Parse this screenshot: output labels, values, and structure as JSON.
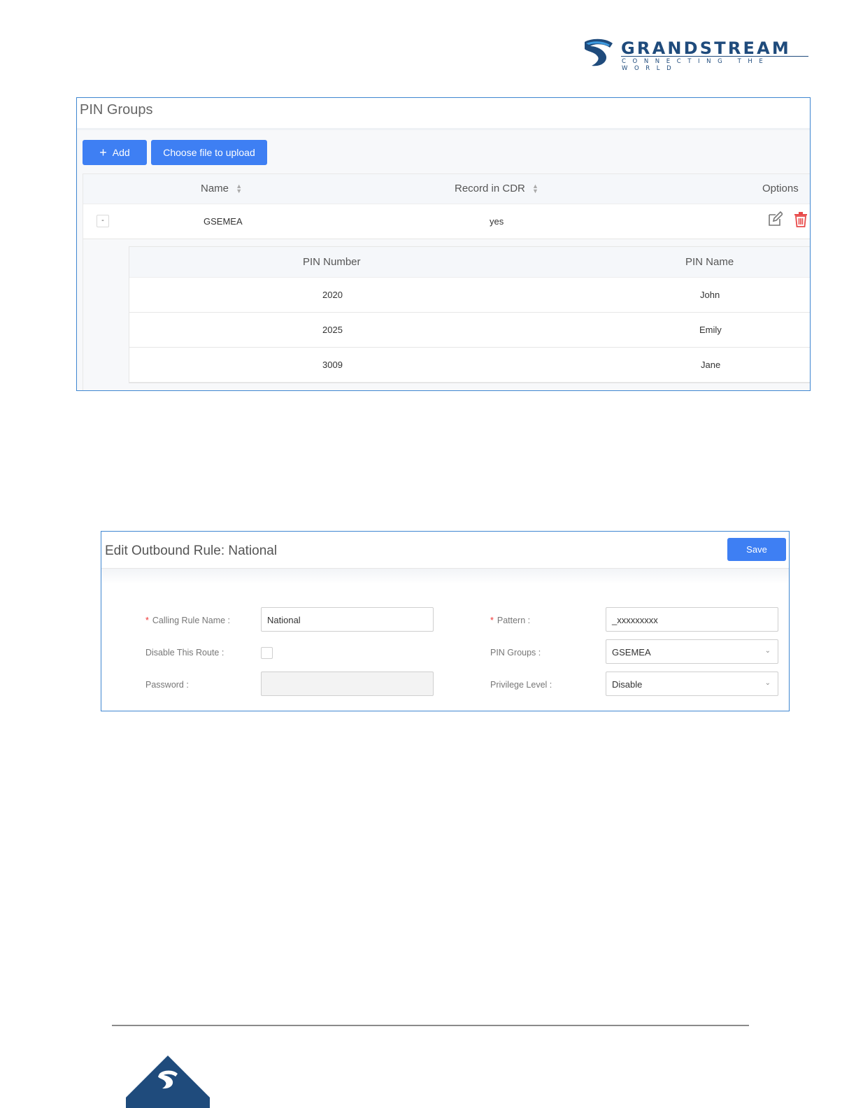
{
  "header": {
    "brand": "GRANDSTREAM",
    "tagline": "CONNECTING THE WORLD",
    "brand_color": "#1f4b7c"
  },
  "pin_groups": {
    "title": "PIN Groups",
    "add_label": "Add",
    "upload_label": "Choose file to upload",
    "columns": {
      "name": "Name",
      "record": "Record in CDR",
      "options": "Options"
    },
    "rows": [
      {
        "expander": "-",
        "name": "GSEMEA",
        "record": "yes"
      }
    ],
    "subtable": {
      "columns": {
        "pin_number": "PIN Number",
        "pin_name": "PIN Name"
      },
      "rows": [
        {
          "pin_number": "2020",
          "pin_name": "John"
        },
        {
          "pin_number": "2025",
          "pin_name": "Emily"
        },
        {
          "pin_number": "3009",
          "pin_name": "Jane"
        }
      ]
    },
    "accent_color": "#3e7ff3",
    "delete_color": "#e84a4a"
  },
  "outbound_rule": {
    "title": "Edit Outbound Rule: National",
    "save_label": "Save",
    "fields": {
      "calling_rule_name": {
        "label": "Calling Rule Name :",
        "value": "National",
        "required": "*"
      },
      "disable_route": {
        "label": "Disable This Route :"
      },
      "password": {
        "label": "Password :",
        "value": ""
      },
      "pattern": {
        "label": "Pattern :",
        "value": "_xxxxxxxxx",
        "required": "*"
      },
      "pin_groups": {
        "label": "PIN Groups :",
        "value": "GSEMEA"
      },
      "privilege_level": {
        "label": "Privilege Level :",
        "value": "Disable"
      }
    }
  }
}
